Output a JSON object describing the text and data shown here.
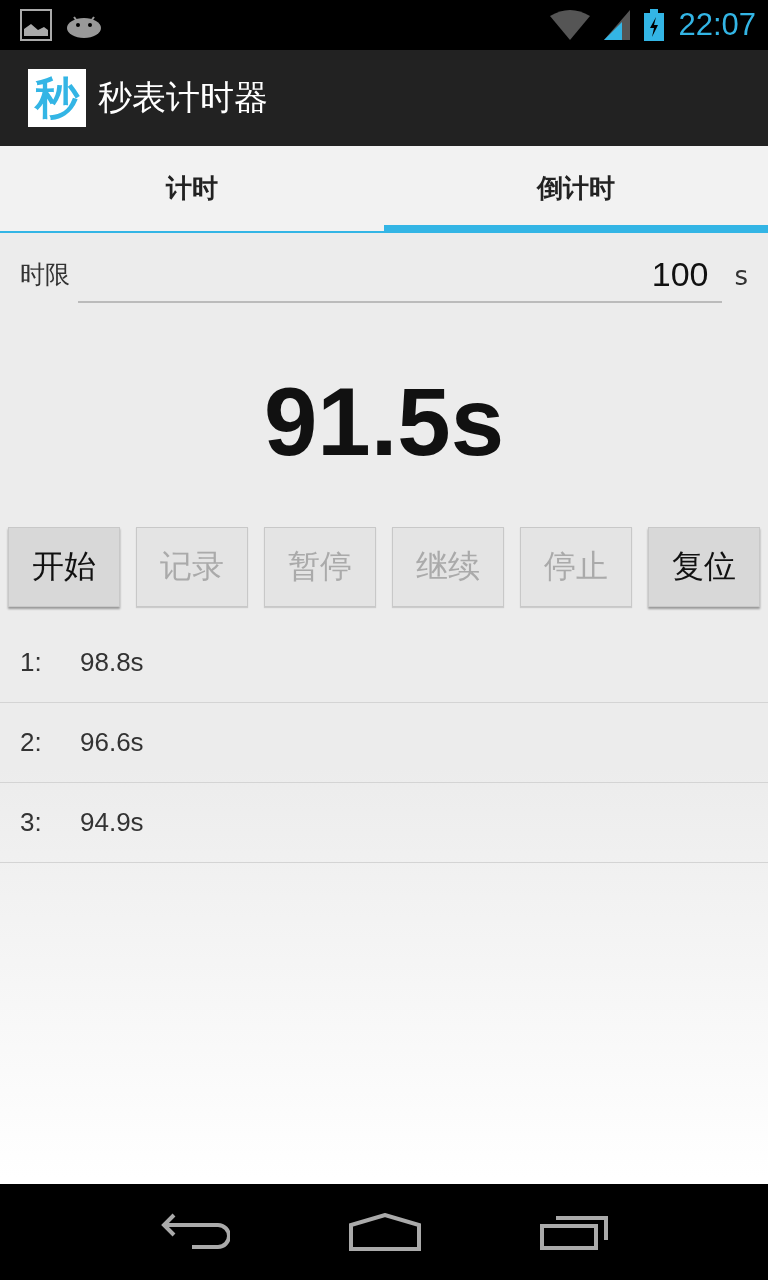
{
  "status_bar": {
    "time": "22:07"
  },
  "app_bar": {
    "icon_text": "秒",
    "title": "秒表计时器"
  },
  "tabs": [
    {
      "label": "计时",
      "selected": false
    },
    {
      "label": "倒计时",
      "selected": true
    }
  ],
  "limit": {
    "label": "时限",
    "value": "100",
    "unit": "s"
  },
  "display": "91.5s",
  "buttons": [
    {
      "label": "开始",
      "disabled": false
    },
    {
      "label": "记录",
      "disabled": true
    },
    {
      "label": "暂停",
      "disabled": true
    },
    {
      "label": "继续",
      "disabled": true
    },
    {
      "label": "停止",
      "disabled": true
    },
    {
      "label": "复位",
      "disabled": false
    }
  ],
  "records": [
    {
      "index": "1:",
      "time": "98.8s"
    },
    {
      "index": "2:",
      "time": "96.6s"
    },
    {
      "index": "3:",
      "time": "94.9s"
    }
  ]
}
